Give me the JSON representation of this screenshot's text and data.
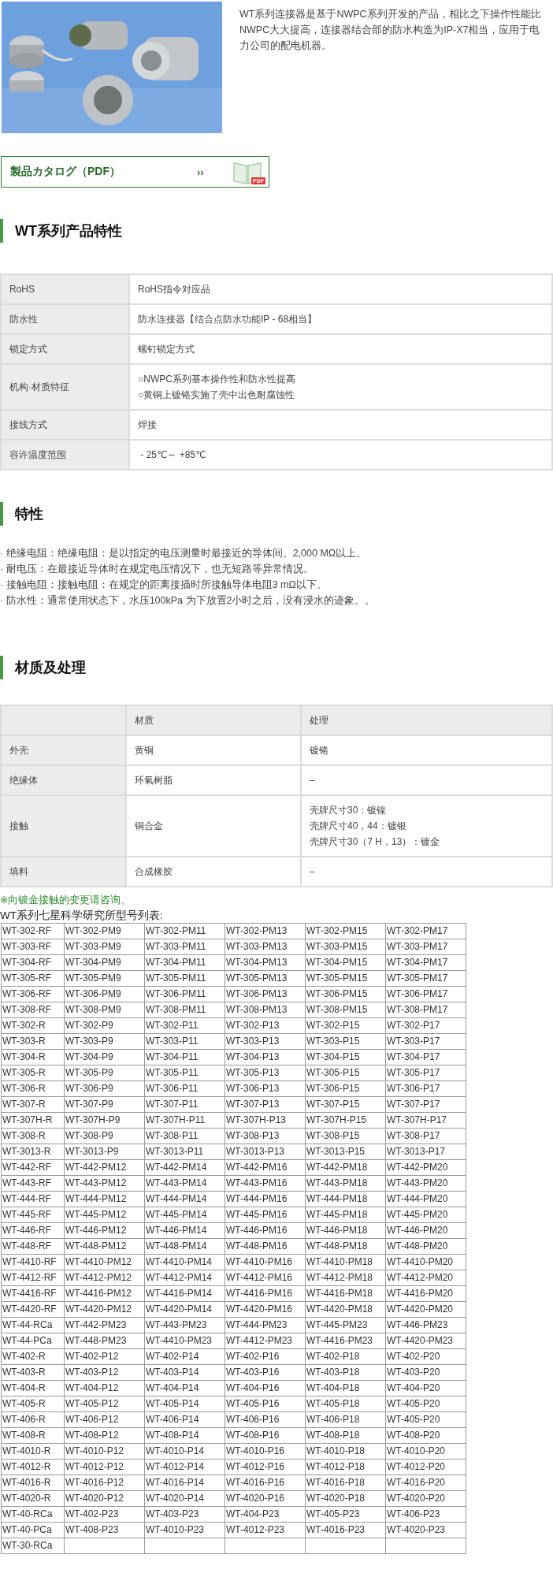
{
  "intro": {
    "description": "WT系列连接器是基于NWPC系列开发的产品，相比之下操作性能比NWPC大大提高，连接器结合部的防水构造为IP-X7相当，应用于电力公司的配电机器。"
  },
  "catalog": {
    "label": "製品カタログ（PDF）",
    "arrow": "››",
    "badge": "PDF"
  },
  "spec_section": {
    "title": "WT系列产品特性",
    "rows": [
      {
        "label": "RoHS",
        "values": [
          "RoHS指令对应品"
        ]
      },
      {
        "label": "防水性",
        "values": [
          "防水连接器【结合点防水功能IP - 68相当】"
        ]
      },
      {
        "label": "锁定方式",
        "values": [
          "螺钉锁定方式"
        ]
      },
      {
        "label": "机构·材质特征",
        "values": [
          "○NWPC系列基本操作性和防水性提高",
          "○黄铜上镀铬实施了壳中出色耐腐蚀性"
        ]
      },
      {
        "label": "接线方式",
        "values": [
          "焊接"
        ]
      },
      {
        "label": "容许温度范围",
        "values": [
          " - 25℃～ +85℃"
        ]
      }
    ]
  },
  "features_section": {
    "title": "特性",
    "items": [
      "· 绝缘电阻：绝缘电阻：是以指定的电压测量时最接近的导体间。2,000 MΩ以上。",
      "· 耐电压：在最接近导体时在规定电压情况下，也无短路等异常情况。",
      "· 接触电阻：接触电阻：在规定的距离接插时所接触导体电阻3 mΩ以下。",
      "· 防水性：通常使用状态下，水压100kPa 为下放置2小时之后，没有浸水的迹象。。"
    ]
  },
  "material_section": {
    "title": "材质及处理",
    "columns": [
      "材质",
      "处理"
    ],
    "rows": [
      {
        "label": "外壳",
        "material": "黄铜",
        "treatment": [
          "镀铬"
        ]
      },
      {
        "label": "绝缘体",
        "material": "环氧树脂",
        "treatment": [
          "–"
        ]
      },
      {
        "label": "接触",
        "material": "铜合金",
        "treatment": [
          "壳牌尺寸30：镀镍",
          "壳牌尺寸40，44：镀银",
          "壳牌尺寸30（7 H，13）：镀金"
        ]
      },
      {
        "label": "填料",
        "material": "合成橡胶",
        "treatment": [
          "–"
        ]
      }
    ],
    "note": "※向镀金接触的变更请咨询。"
  },
  "model_table": {
    "title": "WT系列七星科学研究所型号列表:",
    "rows": [
      [
        "WT-302-RF",
        "WT-302-PM9",
        "WT-302-PM11",
        "WT-302-PM13",
        "WT-302-PM15",
        "WT-302-PM17"
      ],
      [
        "WT-303-RF",
        "WT-303-PM9",
        "WT-303-PM11",
        "WT-303-PM13",
        "WT-303-PM15",
        "WT-303-PM17"
      ],
      [
        "WT-304-RF",
        "WT-304-PM9",
        "WT-304-PM11",
        "WT-304-PM13",
        "WT-304-PM15",
        "WT-304-PM17"
      ],
      [
        "WT-305-RF",
        "WT-305-PM9",
        "WT-305-PM11",
        "WT-305-PM13",
        "WT-305-PM15",
        "WT-305-PM17"
      ],
      [
        "WT-306-RF",
        "WT-306-PM9",
        "WT-306-PM11",
        "WT-306-PM13",
        "WT-306-PM15",
        "WT-306-PM17"
      ],
      [
        "WT-308-RF",
        "WT-308-PM9",
        "WT-308-PM11",
        "WT-308-PM13",
        "WT-308-PM15",
        "WT-308-PM17"
      ],
      [
        "WT-302-R",
        "WT-302-P9",
        "WT-302-P11",
        "WT-302-P13",
        "WT-302-P15",
        "WT-302-P17"
      ],
      [
        "WT-303-R",
        "WT-303-P9",
        "WT-303-P11",
        "WT-303-P13",
        "WT-303-P15",
        "WT-303-P17"
      ],
      [
        "WT-304-R",
        "WT-304-P9",
        "WT-304-P11",
        "WT-304-P13",
        "WT-304-P15",
        "WT-304-P17"
      ],
      [
        "WT-305-R",
        "WT-305-P9",
        "WT-305-P11",
        "WT-305-P13",
        "WT-305-P15",
        "WT-305-P17"
      ],
      [
        "WT-306-R",
        "WT-306-P9",
        "WT-306-P11",
        "WT-306-P13",
        "WT-306-P15",
        "WT-306-P17"
      ],
      [
        "WT-307-R",
        "WT-307-P9",
        "WT-307-P11",
        "WT-307-P13",
        "WT-307-P15",
        "WT-307-P17"
      ],
      [
        "WT-307H-R",
        "WT-307H-P9",
        "WT-307H-P11",
        "WT-307H-P13",
        "WT-307H-P15",
        "WT-307H-P17"
      ],
      [
        "WT-308-R",
        "WT-308-P9",
        "WT-308-P11",
        "WT-308-P13",
        "WT-308-P15",
        "WT-308-P17"
      ],
      [
        "WT-3013-R",
        "WT-3013-P9",
        "WT-3013-P11",
        "WT-3013-P13",
        "WT-3013-P15",
        "WT-3013-P17"
      ],
      [
        "WT-442-RF",
        "WT-442-PM12",
        "WT-442-PM14",
        "WT-442-PM16",
        "WT-442-PM18",
        "WT-442-PM20"
      ],
      [
        "WT-443-RF",
        "WT-443-PM12",
        "WT-443-PM14",
        "WT-443-PM16",
        "WT-443-PM18",
        "WT-443-PM20"
      ],
      [
        "WT-444-RF",
        "WT-444-PM12",
        "WT-444-PM14",
        "WT-444-PM16",
        "WT-444-PM18",
        "WT-444-PM20"
      ],
      [
        "WT-445-RF",
        "WT-445-PM12",
        "WT-445-PM14",
        "WT-445-PM16",
        "WT-445-PM18",
        "WT-445-PM20"
      ],
      [
        "WT-446-RF",
        "WT-446-PM12",
        "WT-446-PM14",
        "WT-446-PM16",
        "WT-446-PM18",
        "WT-446-PM20"
      ],
      [
        "WT-448-RF",
        "WT-448-PM12",
        "WT-448-PM14",
        "WT-448-PM16",
        "WT-448-PM18",
        "WT-448-PM20"
      ],
      [
        "WT-4410-RF",
        "WT-4410-PM12",
        "WT-4410-PM14",
        "WT-4410-PM16",
        "WT-4410-PM18",
        "WT-4410-PM20"
      ],
      [
        "WT-4412-RF",
        "WT-4412-PM12",
        "WT-4412-PM14",
        "WT-4412-PM16",
        "WT-4412-PM18",
        "WT-4412-PM20"
      ],
      [
        "WT-4416-RF",
        "WT-4416-PM12",
        "WT-4416-PM14",
        "WT-4416-PM16",
        "WT-4416-PM18",
        "WT-4416-PM20"
      ],
      [
        "WT-4420-RF",
        "WT-4420-PM12",
        "WT-4420-PM14",
        "WT-4420-PM16",
        "WT-4420-PM18",
        "WT-4420-PM20"
      ],
      [
        "WT-44-RCa",
        "WT-442-PM23",
        "WT-443-PM23",
        "WT-444-PM23",
        "WT-445-PM23",
        "WT-446-PM23"
      ],
      [
        "WT-44-PCa",
        "WT-448-PM23",
        "WT-4410-PM23",
        "WT-4412-PM23",
        "WT-4416-PM23",
        "WT-4420-PM23"
      ],
      [
        "WT-402-R",
        "WT-402-P12",
        "WT-402-P14",
        "WT-402-P16",
        "WT-402-P18",
        "WT-402-P20"
      ],
      [
        "WT-403-R",
        "WT-403-P12",
        "WT-403-P14",
        "WT-403-P16",
        "WT-403-P18",
        "WT-403-P20"
      ],
      [
        "WT-404-R",
        "WT-404-P12",
        "WT-404-P14",
        "WT-404-P16",
        "WT-404-P18",
        "WT-404-P20"
      ],
      [
        "WT-405-R",
        "WT-405-P12",
        "WT-405-P14",
        "WT-405-P16",
        "WT-405-P18",
        "WT-405-P20"
      ],
      [
        "WT-406-R",
        "WT-406-P12",
        "WT-406-P14",
        "WT-406-P16",
        "WT-406-P18",
        "WT-405-P20"
      ],
      [
        "WT-408-R",
        "WT-408-P12",
        "WT-408-P14",
        "WT-408-P16",
        "WT-408-P18",
        "WT-408-P20"
      ],
      [
        "WT-4010-R",
        "WT-4010-P12",
        "WT-4010-P14",
        "WT-4010-P16",
        "WT-4010-P18",
        "WT-4010-P20"
      ],
      [
        "WT-4012-R",
        "WT-4012-P12",
        "WT-4012-P14",
        "WT-4012-P16",
        "WT-4012-P18",
        "WT-4012-P20"
      ],
      [
        "WT-4016-R",
        "WT-4016-P12",
        "WT-4016-P14",
        "WT-4016-P16",
        "WT-4016-P18",
        "WT-4016-P20"
      ],
      [
        "WT-4020-R",
        "WT-4020-P12",
        "WT-4020-P14",
        "WT-4020-P16",
        "WT-4020-P18",
        "WT-4020-P20"
      ],
      [
        "WT-40-RCa",
        "WT-402-P23",
        "WT-403-P23",
        "WT-404-P23",
        "WT-405-P23",
        "WT-406-P23"
      ],
      [
        "WT-40-PCa",
        "WT-408-P23",
        "WT-4010-P23",
        "WT-4012-P23",
        "WT-4016-P23",
        "WT-4020-P23"
      ],
      [
        "WT-30-RCa"
      ]
    ]
  }
}
